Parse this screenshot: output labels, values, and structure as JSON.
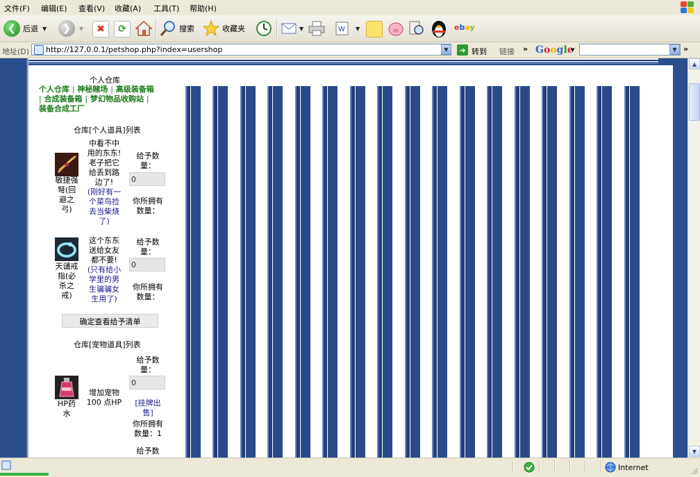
{
  "menu": [
    "文件(F)",
    "编辑(E)",
    "查看(V)",
    "收藏(A)",
    "工具(T)",
    "帮助(H)"
  ],
  "toolbar": {
    "back_label": "后退",
    "search_label": "搜索",
    "favorites_label": "收藏夹"
  },
  "address": {
    "label": "地址(D)",
    "url": "http://127.0.0.1/petshop.php?index=usershop",
    "go_label": "转到",
    "links_label": "链接",
    "google_label": "Google"
  },
  "page": {
    "title": "个人仓库",
    "nav": [
      {
        "label": "个人仓库"
      },
      {
        "label": "神秘赌场"
      },
      {
        "label": "高级装备箱"
      },
      {
        "label": "合成装备箱"
      },
      {
        "label": "梦幻物品收购站"
      },
      {
        "label": "装备合成工厂"
      }
    ],
    "separator": "|",
    "section1_title": "仓库[个人道具]列表",
    "items": [
      {
        "name": "敏捷强弩(回避之弓)",
        "name_lines": [
          "敏捷强",
          "弩(回",
          "避之",
          "弓)"
        ],
        "desc_lines": [
          "中看不中",
          "用的东东!",
          "老子把它",
          "给丢到路",
          "边了!"
        ],
        "note_lines": [
          "(刚好有一",
          "个菜鸟捡",
          "去当柴烧",
          "了)"
        ],
        "give_label_lines": [
          "给予数",
          "量："
        ],
        "qty_value": "0",
        "own_label_lines": [
          "你所拥有",
          "数量："
        ]
      },
      {
        "name": "天谴戒指(必杀之戒)",
        "name_lines": [
          "天谴戒",
          "指(必",
          "杀之",
          "戒)"
        ],
        "desc_lines": [
          "这个东东",
          "送给女友",
          "都不要!"
        ],
        "note_lines": [
          "(只有给小",
          "学里的男",
          "生骗骗女",
          "生用了)"
        ],
        "give_label_lines": [
          "给予数",
          "量："
        ],
        "qty_value": "0",
        "own_label_lines": [
          "你所拥有",
          "数量："
        ]
      }
    ],
    "confirm_button": "确定查看给予清单",
    "section2_title": "仓库[宠物道具]列表",
    "pet_items": [
      {
        "name_lines": [
          "HP药",
          "水"
        ],
        "desc_lines": [
          "增加宠物",
          "100 点HP"
        ],
        "give_label_lines": [
          "给予数",
          "量："
        ],
        "qty_value": "0",
        "sell_lines": [
          "[挂牌出",
          "售]"
        ],
        "own_label_lines": [
          "你所拥有",
          "数量：1"
        ]
      }
    ],
    "next_give_label": "给予数"
  },
  "status": {
    "zone": "Internet"
  },
  "colors": {
    "background_blue": "#2b4e8c",
    "nav_green": "#1b7a1b",
    "note_blue": "#1a1a8c"
  }
}
